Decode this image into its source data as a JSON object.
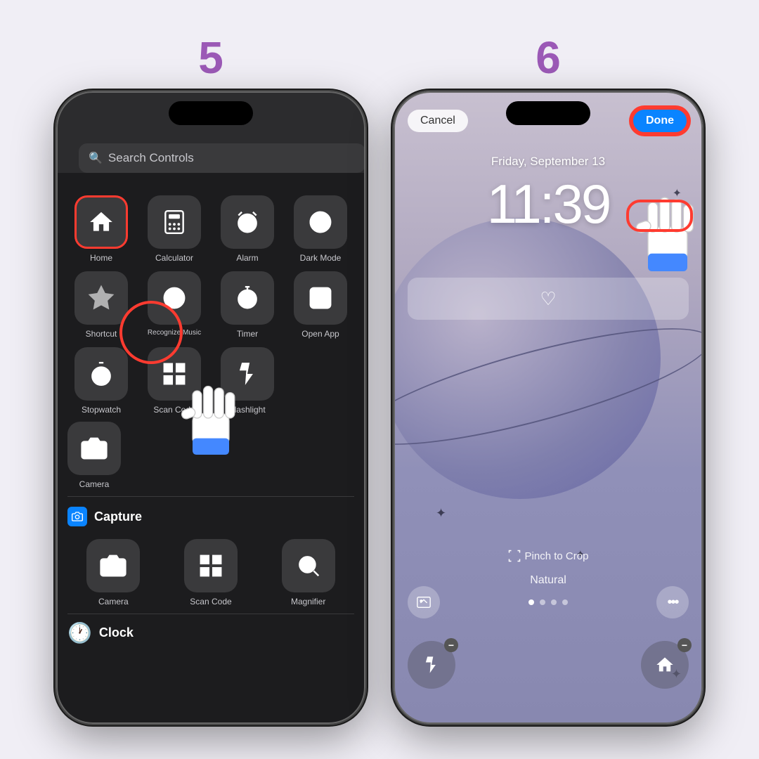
{
  "background_color": "#f0eef5",
  "step5": {
    "number": "5",
    "search_placeholder": "Search Controls",
    "controls": [
      {
        "label": "Home",
        "icon": "home"
      },
      {
        "label": "Calculator",
        "icon": "calc"
      },
      {
        "label": "Alarm",
        "icon": "alarm"
      },
      {
        "label": "Dark Mode",
        "icon": "darkmode"
      },
      {
        "label": "Shortcut",
        "icon": "shortcut"
      },
      {
        "label": "Recognize Music",
        "icon": "music"
      },
      {
        "label": "Timer",
        "icon": "timer"
      },
      {
        "label": "Open App",
        "icon": "openapp"
      },
      {
        "label": "Stopwatch",
        "icon": "stopwatch"
      },
      {
        "label": "Scan Code",
        "icon": "scan"
      },
      {
        "label": "Flashlight",
        "icon": "flashlight"
      },
      {
        "label": "Camera",
        "icon": "camera"
      }
    ],
    "capture_section": "Capture",
    "capture_items": [
      {
        "label": "Camera",
        "icon": "camera"
      },
      {
        "label": "Scan Code",
        "icon": "scan"
      },
      {
        "label": "Magnifier",
        "icon": "magnifier"
      }
    ],
    "clock_label": "Clock"
  },
  "step6": {
    "number": "6",
    "cancel_label": "Cancel",
    "done_label": "Done",
    "date": "Friday, September 13",
    "time": "11:39",
    "pinch_label": "Pinch to Crop",
    "natural_label": "Natural"
  }
}
